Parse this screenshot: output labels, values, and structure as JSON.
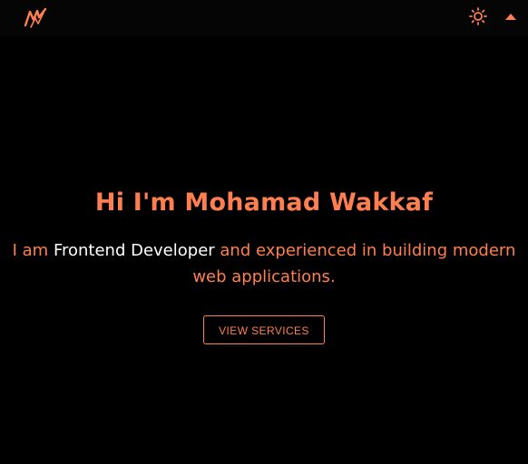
{
  "header": {
    "logo_icon": "mw-logo-icon",
    "theme_icon": "sun-icon",
    "scroll_icon": "chevron-up-icon"
  },
  "hero": {
    "title": "Hi I'm Mohamad Wakkaf",
    "subtitle_prefix": "I am ",
    "subtitle_highlight": "Frontend Developer",
    "subtitle_suffix": " and experienced in building modern web applications.",
    "cta_label": "VIEW SERVICES"
  },
  "colors": {
    "background": "#000000",
    "accent": "#ff7f50",
    "highlight": "#ffffff"
  }
}
